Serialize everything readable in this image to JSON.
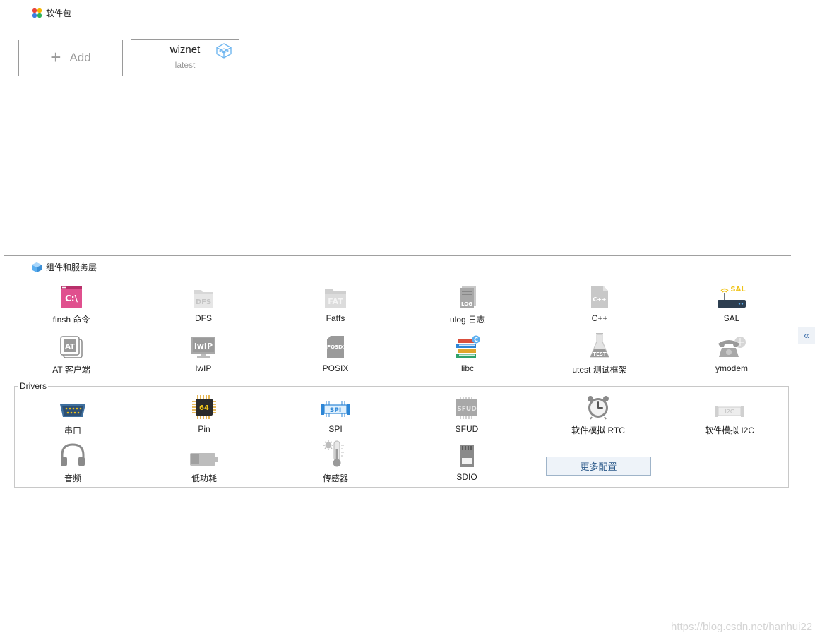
{
  "packages": {
    "title": "软件包",
    "add_label": "Add",
    "add_symbol": "+",
    "items": [
      {
        "name": "wiznet",
        "version": "latest"
      }
    ]
  },
  "components": {
    "title": "组件和服务层",
    "items": [
      {
        "label": "finsh 命令",
        "icon": "terminal-icon",
        "active": true
      },
      {
        "label": "DFS",
        "icon": "dfs-folder-icon",
        "active": false
      },
      {
        "label": "Fatfs",
        "icon": "fat-folder-icon",
        "active": false
      },
      {
        "label": "ulog 日志",
        "icon": "log-icon",
        "active": false
      },
      {
        "label": "C++",
        "icon": "cpp-file-icon",
        "active": false
      },
      {
        "label": "SAL",
        "icon": "router-icon",
        "active": true
      },
      {
        "label": "AT 客户端",
        "icon": "at-icon",
        "active": true
      },
      {
        "label": "lwIP",
        "icon": "lwip-monitor-icon",
        "active": false
      },
      {
        "label": "POSIX",
        "icon": "posix-file-icon",
        "active": false
      },
      {
        "label": "libc",
        "icon": "books-icon",
        "active": true
      },
      {
        "label": "utest 测试框架",
        "icon": "test-flask-icon",
        "active": false
      },
      {
        "label": "ymodem",
        "icon": "telephone-icon",
        "active": false
      }
    ]
  },
  "drivers": {
    "title": "Drivers",
    "items": [
      {
        "label": "串口",
        "icon": "serial-port-icon",
        "active": true
      },
      {
        "label": "Pin",
        "icon": "chip-icon",
        "chip_text": "64",
        "active": true
      },
      {
        "label": "SPI",
        "icon": "spi-icon",
        "active": true
      },
      {
        "label": "SFUD",
        "icon": "sfud-icon",
        "active": false
      },
      {
        "label": "软件模拟 RTC",
        "icon": "alarm-clock-icon",
        "active": true
      },
      {
        "label": "软件模拟 I2C",
        "icon": "i2c-icon",
        "active": false
      },
      {
        "label": "音频",
        "icon": "headphones-icon",
        "active": true
      },
      {
        "label": "低功耗",
        "icon": "battery-icon",
        "active": false
      },
      {
        "label": "传感器",
        "icon": "thermometer-icon",
        "active": false
      },
      {
        "label": "SDIO",
        "icon": "sd-card-icon",
        "active": true
      }
    ],
    "more_label": "更多配置"
  },
  "icon_texts": {
    "finsh": "C:\\",
    "dfs": "DFS",
    "fat": "FAT",
    "log": "LOG",
    "cpp": "C++",
    "sal": "SAL",
    "at": "AT",
    "lwip": "lwIP",
    "posix": "POSIX",
    "libc_badge": "C",
    "test": "TEST",
    "spi": "SPI",
    "sfud": "SFUD",
    "i2c": "I2C"
  },
  "collapse_label": "«",
  "watermark": "https://blog.csdn.net/hanhui22"
}
